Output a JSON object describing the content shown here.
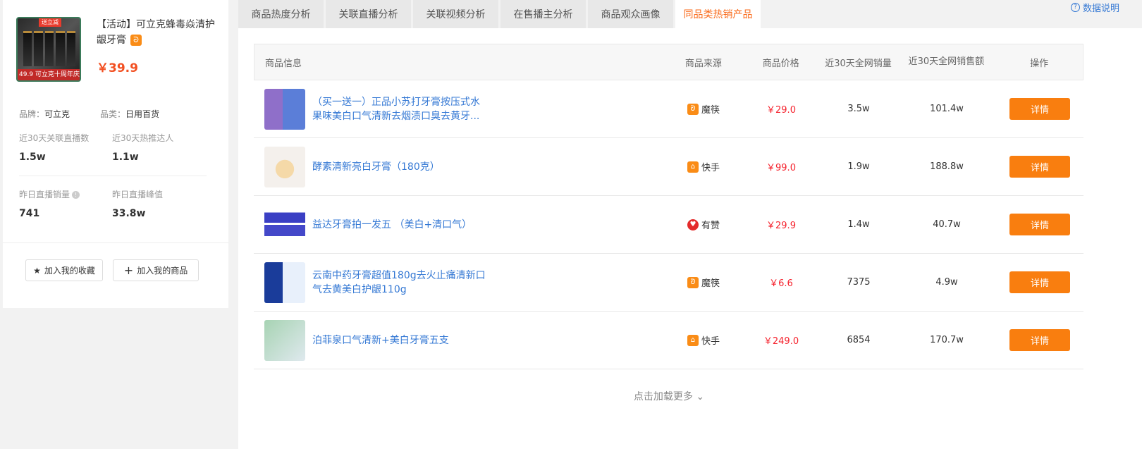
{
  "product": {
    "title": "【活动】可立克蜂毒焱清护龈牙膏",
    "platform_icon": "mofang-icon",
    "price": "￥39.9",
    "image": {
      "tag": "送立减",
      "ribbon": "49.9 可立克十周年庆"
    },
    "brand_label": "品牌：",
    "brand": "可立克",
    "category_label": "品类：",
    "category": "日用百货",
    "stats": [
      {
        "label": "近30天关联直播数",
        "value": "1.5w"
      },
      {
        "label": "近30天热推达人",
        "value": "1.1w"
      },
      {
        "label": "昨日直播销量",
        "value": "741"
      },
      {
        "label": "昨日直播峰值",
        "value": "33.8w"
      }
    ],
    "btn_favorite": "加入我的收藏",
    "btn_add": "加入我的商品"
  },
  "tabs": [
    "商品热度分析",
    "关联直播分析",
    "关联视频分析",
    "在售播主分析",
    "商品观众画像",
    "同品类热销产品"
  ],
  "active_tab": 5,
  "data_link": "数据说明",
  "table": {
    "headers": [
      "商品信息",
      "商品来源",
      "商品价格",
      "近30天全网销量",
      "近30天全网销售额",
      "操作"
    ],
    "rows": [
      {
        "name": "（买一送一）正品小苏打牙膏按压式水果味美白口气清新去烟渍口臭去黄牙...",
        "source": "魔筷",
        "price": "￥29.0",
        "sales": "3.5w",
        "amount": "101.4w",
        "op": "详情"
      },
      {
        "name": "酵素清新亮白牙膏（180克）",
        "source": "快手",
        "price": "￥99.0",
        "sales": "1.9w",
        "amount": "188.8w",
        "op": "详情"
      },
      {
        "name": "益达牙膏拍一发五 （美白+清口气）",
        "source": "有赞",
        "price": "￥29.9",
        "sales": "1.4w",
        "amount": "40.7w",
        "op": "详情"
      },
      {
        "name": "云南中药牙膏超值180g去火止痛清新口气去黄美白护龈110g",
        "source": "魔筷",
        "price": "￥6.6",
        "sales": "7375",
        "amount": "4.9w",
        "op": "详情"
      },
      {
        "name": "泊菲泉口气清新+美白牙膏五支",
        "source": "快手",
        "price": "￥249.0",
        "sales": "6854",
        "amount": "170.7w",
        "op": "详情"
      }
    ]
  },
  "load_more": "点击加载更多"
}
